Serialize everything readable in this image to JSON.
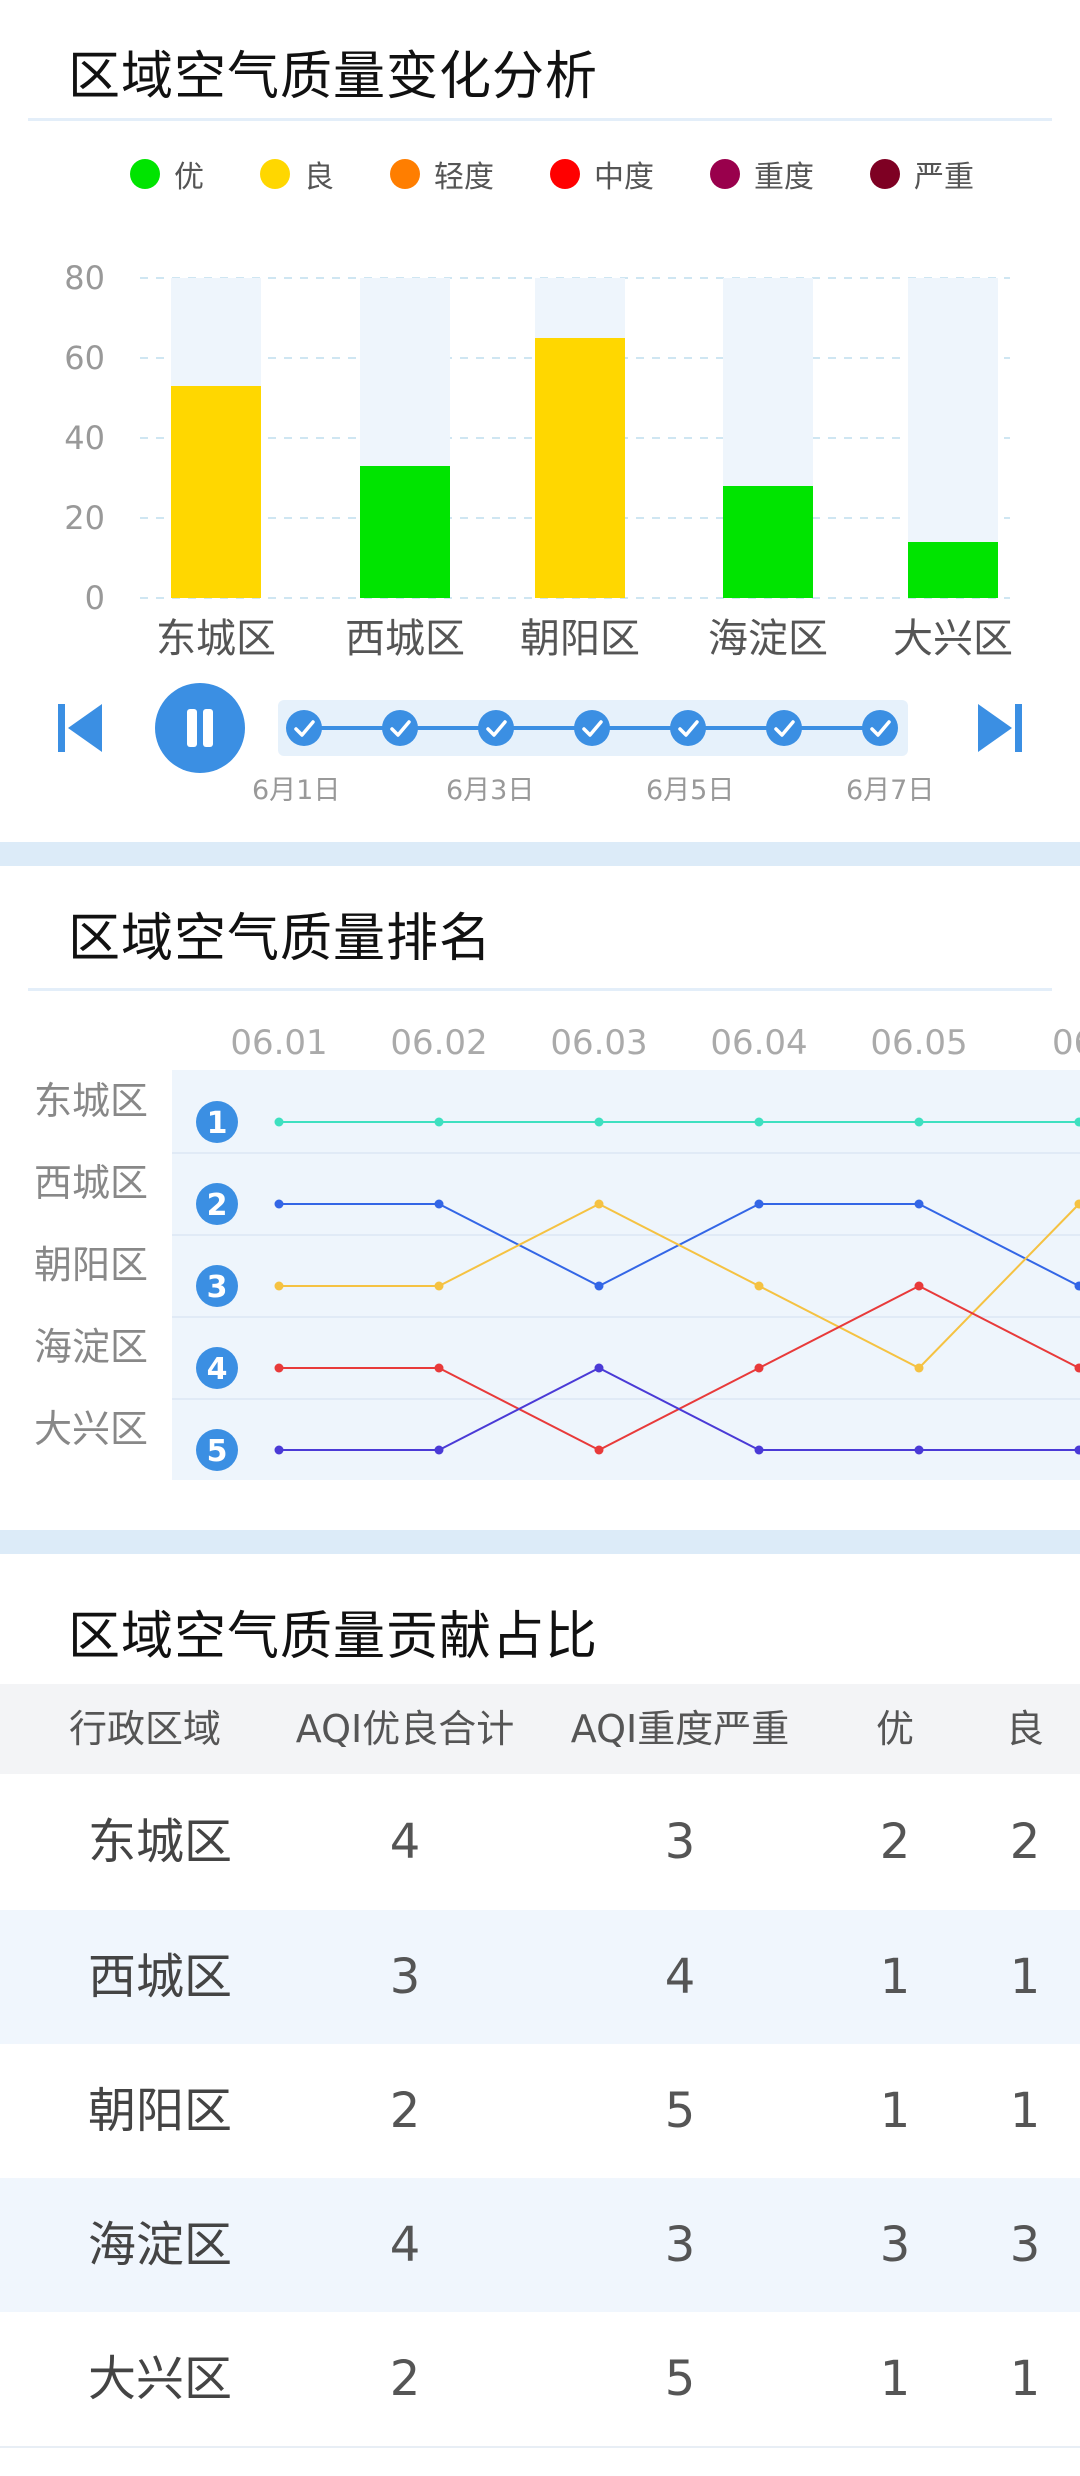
{
  "bar_section": {
    "title": "区域空气质量变化分析",
    "legend": [
      {
        "label": "优",
        "color": "#00e400"
      },
      {
        "label": "良",
        "color": "#ffd700"
      },
      {
        "label": "轻度",
        "color": "#ff7e00"
      },
      {
        "label": "中度",
        "color": "#ff0000"
      },
      {
        "label": "重度",
        "color": "#99004c"
      },
      {
        "label": "严重",
        "color": "#7e0023"
      }
    ],
    "timeline": {
      "labels": [
        "6月1日",
        "6月3日",
        "6月5日",
        "6月7日"
      ],
      "steps": 7
    }
  },
  "chart_data": [
    {
      "type": "bar",
      "categories": [
        "东城区",
        "西城区",
        "朝阳区",
        "海淀区",
        "大兴区"
      ],
      "values": [
        53,
        33,
        65,
        28,
        14
      ],
      "bar_colors": [
        "#ffd700",
        "#00e400",
        "#ffd700",
        "#00e400",
        "#00e400"
      ],
      "background_max": 80,
      "ylim": [
        0,
        80
      ],
      "yticks": [
        0,
        20,
        40,
        60,
        80
      ],
      "grid": true
    },
    {
      "type": "line",
      "x": [
        "06.01",
        "06.02",
        "06.03",
        "06.04",
        "06.05",
        "06."
      ],
      "y_labels": [
        "东城区",
        "西城区",
        "朝阳区",
        "海淀区",
        "大兴区"
      ],
      "rank_badges": [
        "1",
        "2",
        "3",
        "4",
        "5"
      ],
      "ylim": [
        1,
        5
      ],
      "series": [
        {
          "color": "#3ee0c0",
          "values": [
            1,
            1,
            1,
            1,
            1,
            1
          ]
        },
        {
          "color": "#3366e6",
          "values": [
            2,
            2,
            3,
            2,
            2,
            3
          ]
        },
        {
          "color": "#f5c242",
          "values": [
            3,
            3,
            2,
            3,
            4,
            2
          ]
        },
        {
          "color": "#e83a3a",
          "values": [
            4,
            4,
            5,
            4,
            3,
            4
          ]
        },
        {
          "color": "#4a3ad6",
          "values": [
            5,
            5,
            4,
            5,
            5,
            5
          ]
        }
      ]
    }
  ],
  "rank_section": {
    "title": "区域空气质量排名"
  },
  "table_section": {
    "title": "区域空气质量贡献占比",
    "headers": [
      "行政区域",
      "AQI优良合计",
      "AQI重度严重",
      "优",
      "良"
    ],
    "rows": [
      [
        "东城区",
        "4",
        "3",
        "2",
        "2"
      ],
      [
        "西城区",
        "3",
        "4",
        "1",
        "1"
      ],
      [
        "朝阳区",
        "2",
        "5",
        "1",
        "1"
      ],
      [
        "海淀区",
        "4",
        "3",
        "3",
        "3"
      ],
      [
        "大兴区",
        "2",
        "5",
        "1",
        "1"
      ]
    ]
  }
}
